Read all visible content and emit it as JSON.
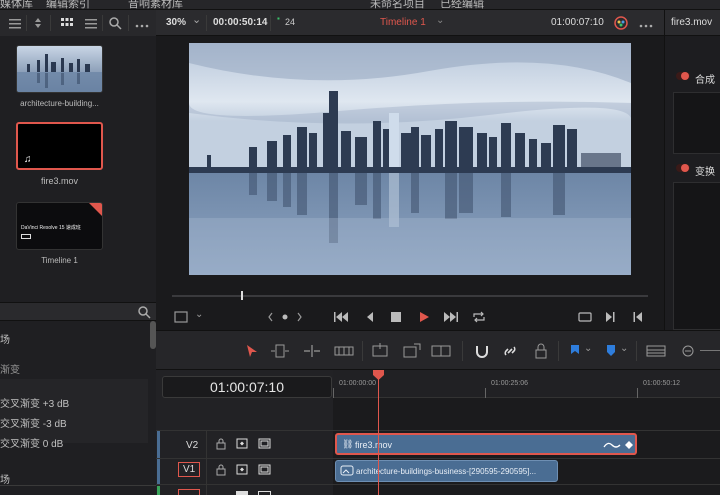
{
  "topbar": {
    "item1": "媒体库",
    "item2": "编辑索引",
    "item3": "音响素材库",
    "project_title": "未命名项目",
    "mode": "已经编辑"
  },
  "viewer_header": {
    "zoom": "30%",
    "zoom_arrow": "⌄",
    "source_timecode": "00:00:50:14",
    "fps_label": "24",
    "timeline_name": "Timeline 1",
    "timeline_timecode": "01:00:07:10"
  },
  "inspector": {
    "filename": "fire3.mov",
    "section1": "合成",
    "section2": "变换"
  },
  "media_pool": {
    "items": [
      {
        "name": "architecture-building...",
        "kind": "image"
      },
      {
        "name": "fire3.mov",
        "kind": "black"
      },
      {
        "name": "Timeline 1",
        "kind": "timeline",
        "overlay": "DaVinci Resolve 15 速成班"
      }
    ]
  },
  "effects": {
    "section1": "场",
    "category": "渐变",
    "items": [
      "交叉渐变 +3 dB",
      "交叉渐变 -3 dB",
      "交叉渐变 0 dB"
    ],
    "section2": "场"
  },
  "timeline": {
    "timecode": "01:00:07:10",
    "ruler": [
      "01:00:00:00",
      "01:00:25:06",
      "01:00:50:12"
    ],
    "tracks": [
      {
        "name": "V2"
      },
      {
        "name": "V1"
      }
    ],
    "clips": {
      "v2": "fire3.mov",
      "v1": "architecture-buildings-business-[290595-290595]..."
    }
  },
  "colors": {
    "accent": "#e0574d",
    "clip_blue": "#4a6d93",
    "panel": "#1e1e21"
  }
}
